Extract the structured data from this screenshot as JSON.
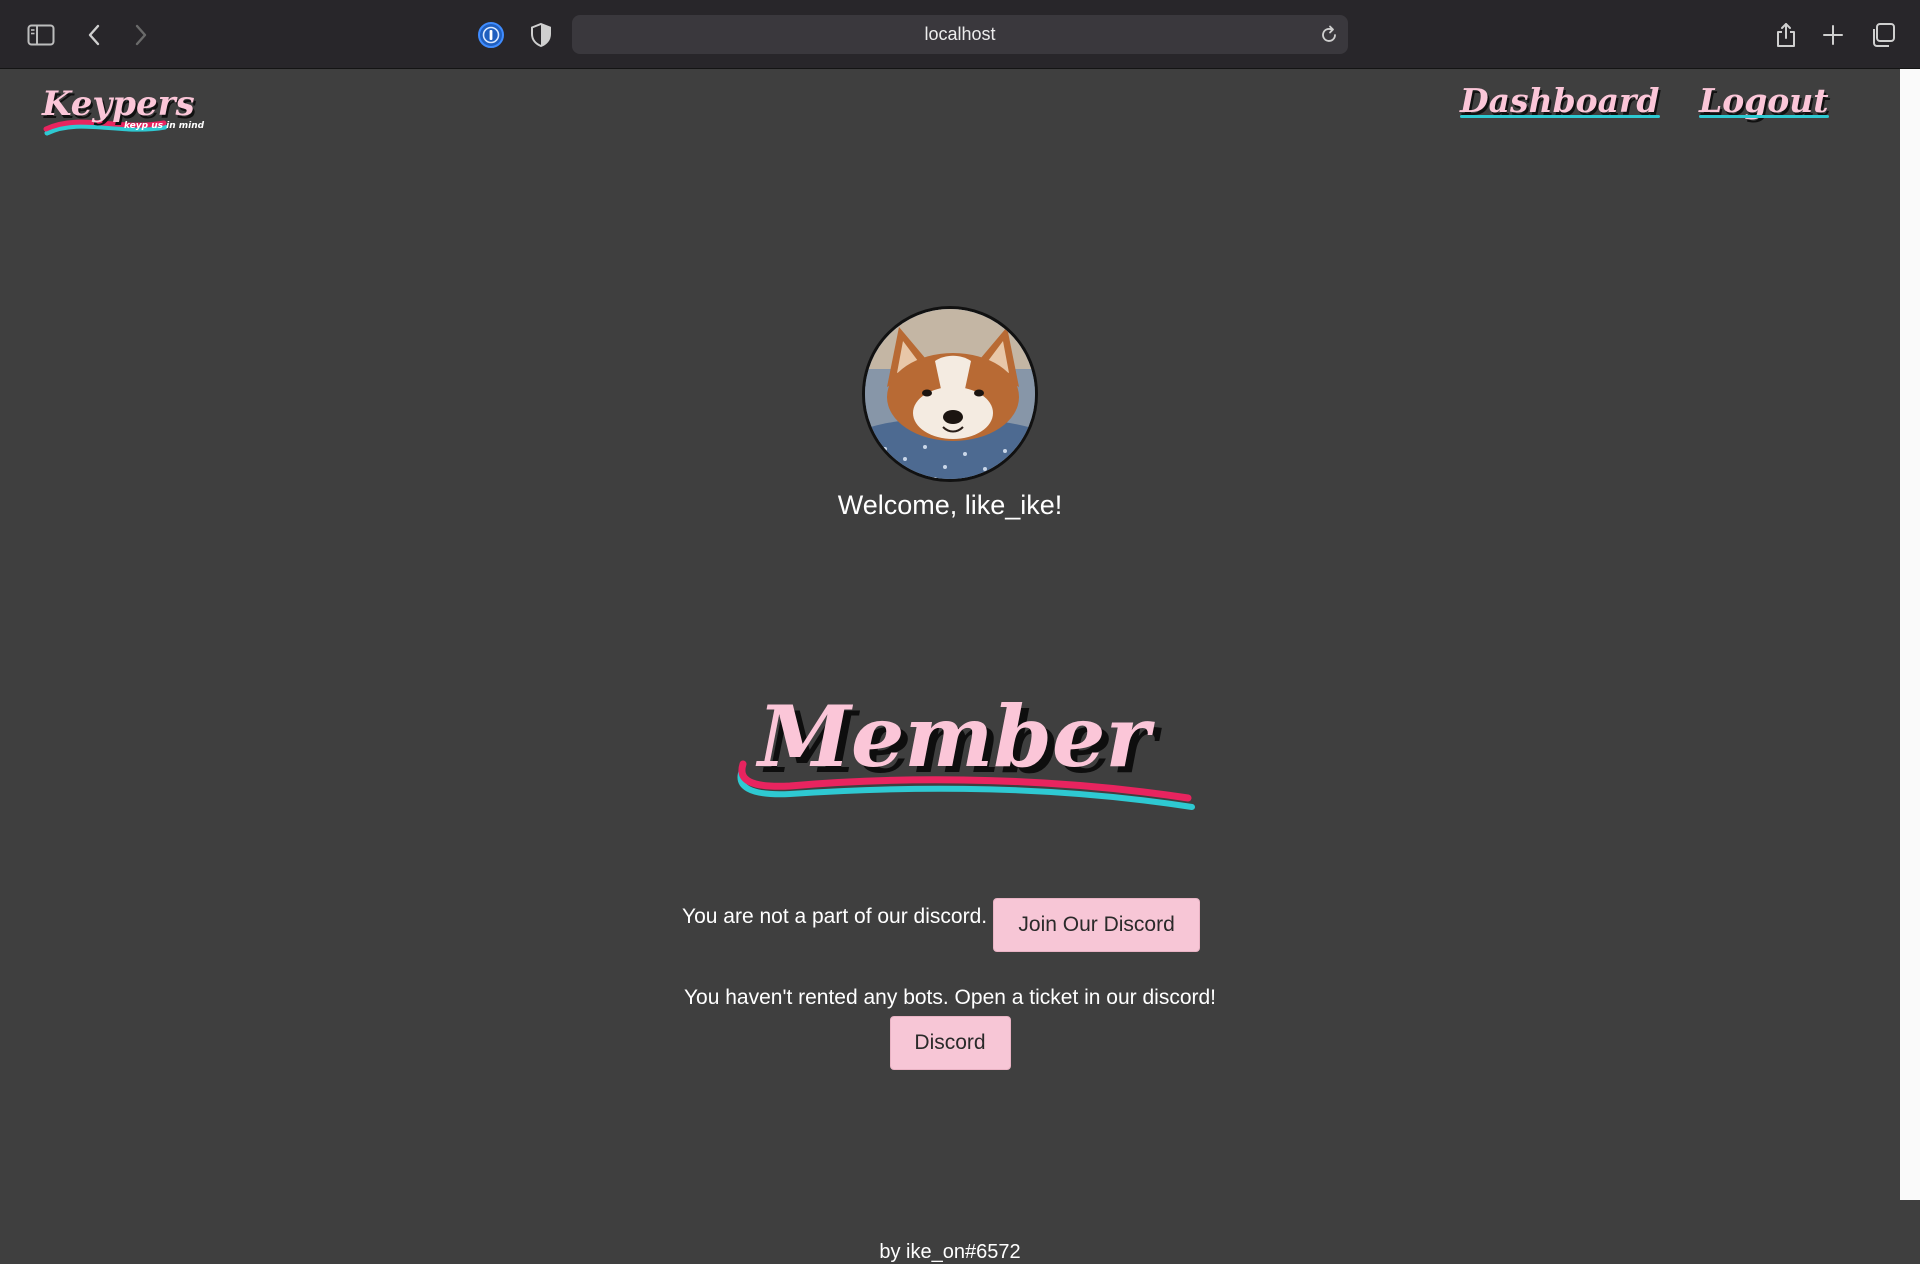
{
  "browser": {
    "url": "localhost",
    "icons": {
      "sidebar": "sidebar-icon",
      "back": "chevron-left-icon",
      "forward": "chevron-right-icon",
      "password_manager": "onepassword-icon",
      "privacy": "shield-icon",
      "reload": "reload-icon",
      "share": "share-icon",
      "new_tab": "plus-icon",
      "tabs": "tab-overview-icon"
    }
  },
  "header": {
    "logo_title": "Keypers",
    "logo_tagline": "keyp us in mind",
    "nav": {
      "dashboard": "Dashboard",
      "logout": "Logout"
    }
  },
  "main": {
    "welcome": "Welcome, like_ike!",
    "role": "Member",
    "discord_status": "You are not a part of our discord.",
    "join_button": "Join Our Discord",
    "bots_status": "You haven't rented any bots. Open a ticket in our discord!",
    "discord_button": "Discord"
  },
  "footer": {
    "credit": "by ike_on#6572"
  },
  "colors": {
    "background": "#3f3f3f",
    "chrome": "#28262a",
    "accent_pink": "#fbc6d8",
    "accent_red": "#e8245f",
    "accent_teal": "#2ec9d2",
    "button_bg": "#f7c6d6"
  }
}
